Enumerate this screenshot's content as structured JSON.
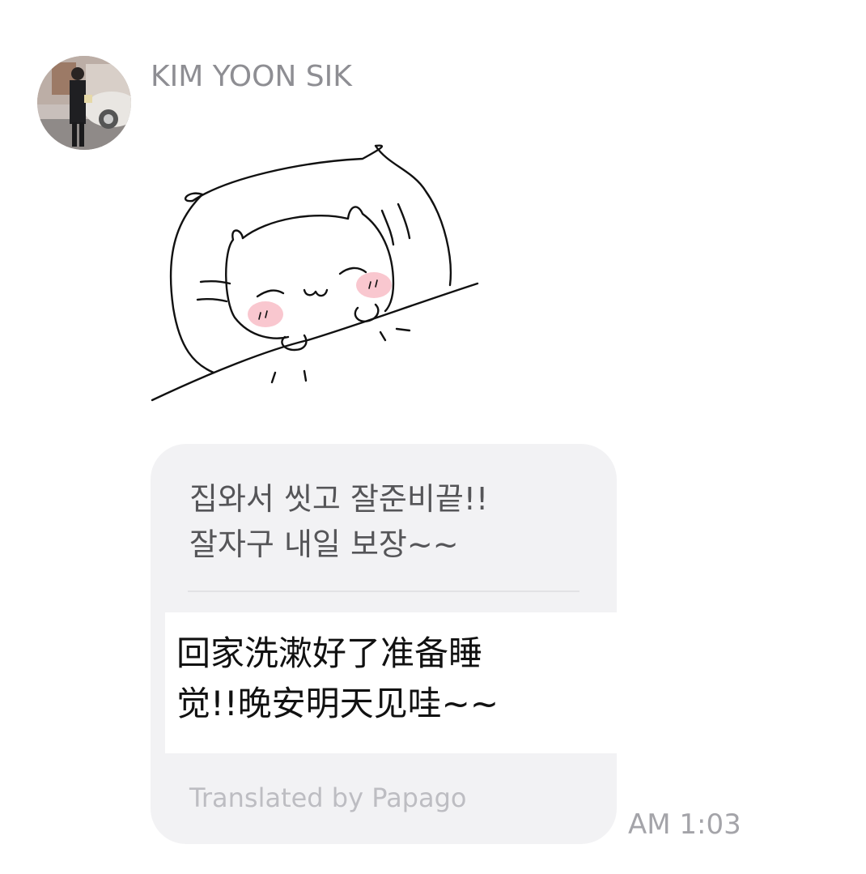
{
  "chat": {
    "sender": {
      "name": "KIM YOON SIK",
      "avatar_icon": "profile-photo"
    },
    "sticker": {
      "icon": "sleeping-cat-sticker"
    },
    "message": {
      "original": "집와서 씻고 잘준비끝!!\n잘자구 내일 보장~~",
      "translated": "回家洗漱好了准备睡\n觉!!晚安明天见哇~~",
      "translated_by": "Translated by Papago",
      "time": "AM 1:03"
    }
  },
  "colors": {
    "background": "#ffffff",
    "bubble": "#f2f2f4",
    "name": "#8e8e93",
    "original_text": "#555558",
    "translated_text": "#111111",
    "muted": "#bdbdc2",
    "cheek_blush": "#f4a6b4"
  }
}
